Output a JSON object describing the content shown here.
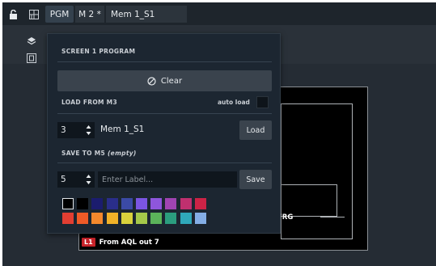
{
  "toolbar": {
    "pgm_label": "PGM",
    "m2_label": "M 2 *",
    "mem_label": "Mem 1_S1"
  },
  "panel": {
    "screen_title": "SCREEN 1 PROGRAM",
    "clear_label": "Clear",
    "load_title": "LOAD FROM M3",
    "auto_load_label": "auto load",
    "load_number": "3",
    "load_mem_name": "Mem 1_S1",
    "load_button": "Load",
    "save_title": "SAVE TO M5",
    "save_title_note": "(empty)",
    "save_number": "5",
    "label_placeholder": "Enter Label...",
    "save_button": "Save"
  },
  "colors": {
    "row1": [
      "#000000",
      "#000000",
      "#1b1c6e",
      "#2a2e8a",
      "#3b4aa6",
      "#7b55e3",
      "#8e56dc",
      "#a044b2",
      "#c0306f",
      "#cc2346"
    ],
    "row2": [
      "#e23e32",
      "#ef5a27",
      "#f5892c",
      "#f1b228",
      "#d9d23c",
      "#a5c94a",
      "#5bb35a",
      "#2b9d7e",
      "#2fa8b9",
      "#84aee6"
    ]
  },
  "canvas": {
    "frg_label": "FRG",
    "source_tag": "L1",
    "source_text": "From AQL out 7"
  }
}
